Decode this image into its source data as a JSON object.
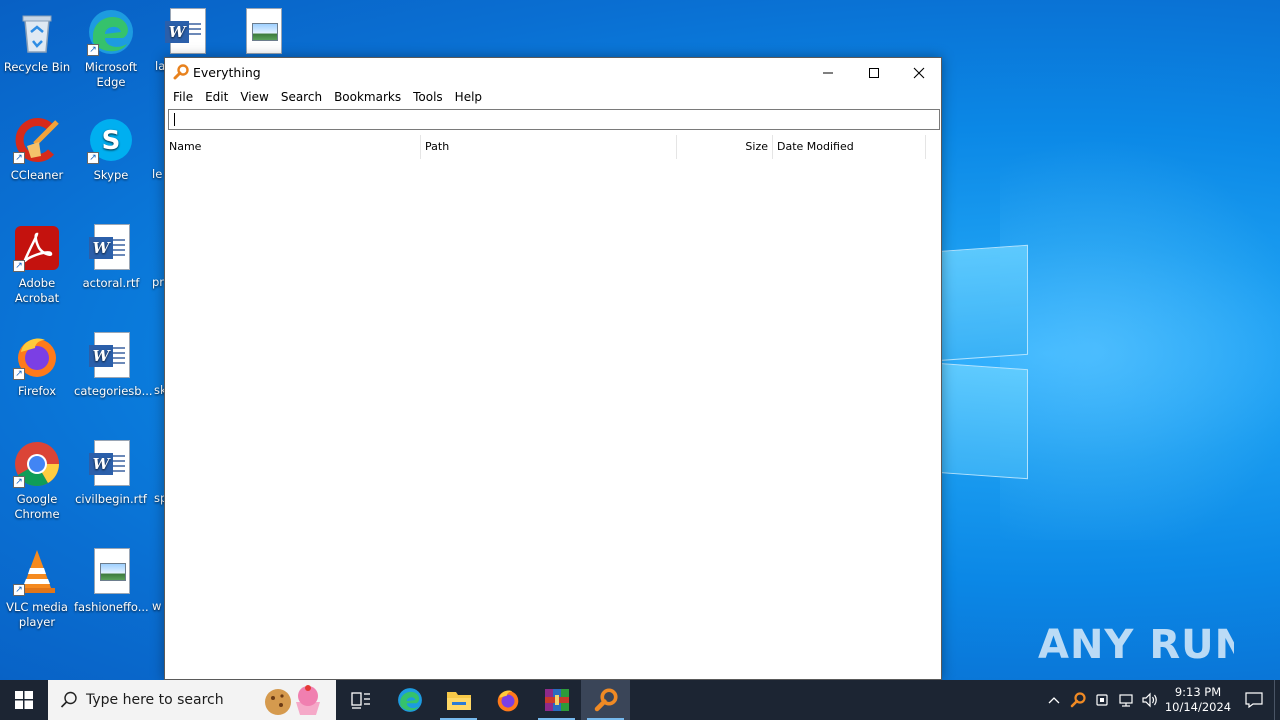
{
  "desktop": {
    "icons": [
      {
        "label": "Recycle Bin"
      },
      {
        "label": "Microsoft Edge"
      },
      {
        "label": "CCleaner"
      },
      {
        "label": "Skype"
      },
      {
        "label": "Adobe Acrobat"
      },
      {
        "label": "actoral.rtf"
      },
      {
        "label": "Firefox"
      },
      {
        "label": "categoriesb..."
      },
      {
        "label": "Google Chrome"
      },
      {
        "label": "civilbegin.rtf"
      },
      {
        "label": "VLC media player"
      },
      {
        "label": "fashioneffo..."
      }
    ],
    "clipped_labels": [
      "la",
      "le",
      "pr",
      "sk",
      "sp",
      "w"
    ],
    "watermark": "ANY RUN"
  },
  "window": {
    "title": "Everything",
    "menu": [
      "File",
      "Edit",
      "View",
      "Search",
      "Bookmarks",
      "Tools",
      "Help"
    ],
    "search_value": "",
    "columns": [
      "Name",
      "Path",
      "Size",
      "Date Modified"
    ]
  },
  "taskbar": {
    "search_placeholder": "Type here to search",
    "apps": [
      "task-view",
      "edge",
      "file-explorer",
      "firefox",
      "winrar",
      "everything"
    ],
    "active_app": "everything",
    "time": "9:13 PM",
    "date": "10/14/2024"
  },
  "colors": {
    "accent": "#0a8de0",
    "taskbar": "#1c2533",
    "everything_orange": "#e8821e"
  }
}
